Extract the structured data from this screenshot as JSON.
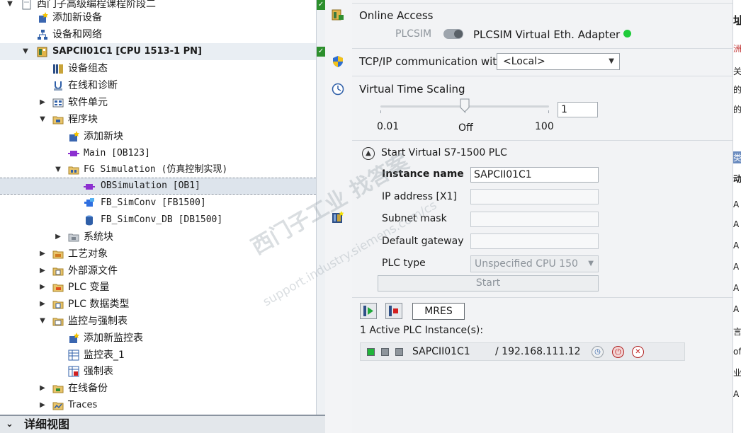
{
  "tree": {
    "items": [
      {
        "label": "西门子高级编程课程阶段二",
        "bold": false
      },
      {
        "label": "添加新设备"
      },
      {
        "label": "设备和网络"
      },
      {
        "label": "SAPCII01C1 [CPU 1513-1 PN]",
        "bold": true
      },
      {
        "label": "设备组态"
      },
      {
        "label": "在线和诊断"
      },
      {
        "label": "软件单元"
      },
      {
        "label": "程序块"
      },
      {
        "label": "添加新块"
      },
      {
        "label": "Main [OB123]"
      },
      {
        "label": "FG Simulation (仿真控制实现)"
      },
      {
        "label": "OBSimulation [OB1]"
      },
      {
        "label": "FB_SimConv [FB1500]"
      },
      {
        "label": "FB_SimConv_DB [DB1500]"
      },
      {
        "label": "系统块"
      },
      {
        "label": "工艺对象"
      },
      {
        "label": "外部源文件"
      },
      {
        "label": "PLC 变量"
      },
      {
        "label": "PLC 数据类型"
      },
      {
        "label": "监控与强制表"
      },
      {
        "label": "添加新监控表"
      },
      {
        "label": "监控表_1"
      },
      {
        "label": "强制表"
      },
      {
        "label": "在线备份"
      },
      {
        "label": "Traces"
      }
    ],
    "detail_view": "详细视图"
  },
  "panel": {
    "online_access": {
      "title": "Online Access",
      "plcsim_label": "PLCSIM",
      "adapter_label": "PLCSIM Virtual Eth. Adapter"
    },
    "tcpip": {
      "label": "TCP/IP communication wit",
      "value": "<Local>"
    },
    "vts": {
      "title": "Virtual Time Scaling",
      "value": "1",
      "min_label": "0.01",
      "mid_label": "Off",
      "max_label": "100"
    },
    "start_section": {
      "title": "Start Virtual S7-1500 PLC",
      "instance_label": "Instance name",
      "instance_value": "SAPCII01C1",
      "ip_label": "IP address [X1]",
      "subnet_label": "Subnet mask",
      "gateway_label": "Default gateway",
      "plctype_label": "PLC type",
      "plctype_value": "Unspecified CPU 150",
      "start_label": "Start"
    },
    "toolbar": {
      "mres_label": "MRES"
    },
    "active": {
      "title": "1 Active PLC Instance(s):",
      "name": "SAPCII01C1",
      "ip": "/ 192.168.111.12"
    }
  },
  "watermark": {
    "line1": "西门子工业 找答案",
    "line2": "support.industry.siemens.com/cs"
  },
  "right_edge": [
    "址",
    "洲",
    "关",
    "的",
    "的",
    "类",
    "动",
    "A",
    "A",
    "A",
    "A",
    "A",
    "A",
    "言",
    "ofi",
    "业",
    "A"
  ]
}
